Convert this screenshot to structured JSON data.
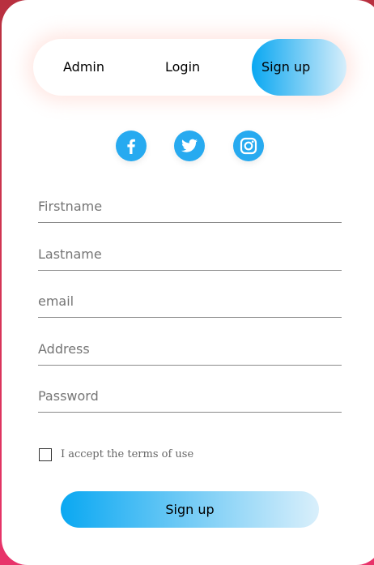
{
  "tabs": {
    "admin": "Admin",
    "login": "Login",
    "signup": "Sign up"
  },
  "social": [
    "facebook-icon",
    "twitter-icon",
    "instagram-icon"
  ],
  "form": {
    "firstname_placeholder": "Firstname",
    "lastname_placeholder": "Lastname",
    "email_placeholder": "email",
    "address_placeholder": "Address",
    "password_placeholder": "Password",
    "terms_label": "I accept the terms of use",
    "submit_label": "Sign up"
  },
  "colors": {
    "accent": "#27aaf0",
    "gradient_start": "#0aa8f2",
    "gradient_end": "#d9effb",
    "background": "#d23553"
  }
}
